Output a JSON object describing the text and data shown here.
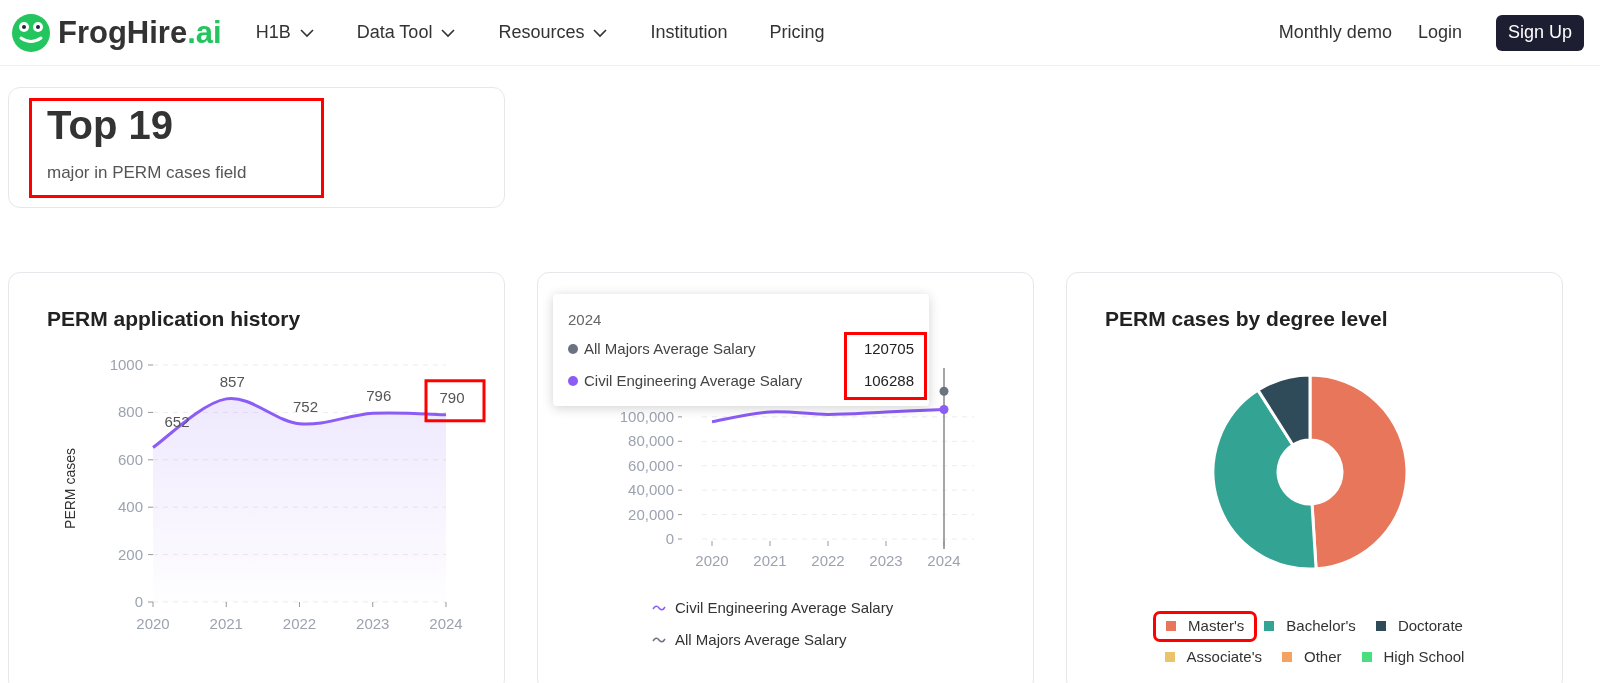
{
  "brand": {
    "name": "FrogHire",
    "suffix": ".ai"
  },
  "nav": {
    "items": [
      {
        "label": "H1B",
        "dropdown": true
      },
      {
        "label": "Data Tool",
        "dropdown": true
      },
      {
        "label": "Resources",
        "dropdown": true
      },
      {
        "label": "Institution",
        "dropdown": false
      },
      {
        "label": "Pricing",
        "dropdown": false
      }
    ],
    "right": [
      {
        "label": "Monthly demo",
        "kind": "link"
      },
      {
        "label": "Login",
        "kind": "link"
      },
      {
        "label": "Sign Up",
        "kind": "primary"
      }
    ]
  },
  "stat_card": {
    "value": "Top 19",
    "caption": "major in PERM cases field",
    "highlighted": true
  },
  "history_card": {
    "title": "PERM application history",
    "last_label_highlighted": true,
    "chart_data": {
      "type": "area",
      "ylabel": "PERM cases",
      "categories": [
        "2020",
        "2021",
        "2022",
        "2023",
        "2024"
      ],
      "values": [
        652,
        857,
        752,
        796,
        790
      ],
      "ylim": [
        0,
        1000
      ],
      "yticks": [
        0,
        200,
        400,
        600,
        800,
        1000
      ],
      "grid": true,
      "data_labels": true
    }
  },
  "salary_card": {
    "chart_data": {
      "type": "line",
      "categories": [
        "2020",
        "2021",
        "2022",
        "2023",
        "2024"
      ],
      "series": [
        {
          "name": "Civil Engineering Average Salary",
          "color": "#8b5cf6",
          "values": [
            96000,
            104000,
            102000,
            104000,
            106000
          ],
          "marker": true
        },
        {
          "name": "All Majors Average Salary",
          "color": "#6b7280",
          "values": [
            null,
            null,
            null,
            null,
            121000
          ],
          "marker": true
        }
      ],
      "ylim": [
        0,
        140000
      ],
      "ref_lines": [
        {
          "axis": "x",
          "value": "2024"
        }
      ],
      "grid": true,
      "yticks": [
        {
          "value": 0,
          "label": "0"
        },
        {
          "value": 20000,
          "label": "20,000"
        },
        {
          "value": 40000,
          "label": "40,000"
        },
        {
          "value": 60000,
          "label": "60,000"
        },
        {
          "value": 80000,
          "label": "80,000"
        },
        {
          "value": 100000,
          "label": "100,000"
        }
      ]
    },
    "tooltip": {
      "title": "2024",
      "values_highlighted": true,
      "rows": [
        {
          "name": "All Majors Average Salary",
          "value": "120705",
          "color": "#6b7280"
        },
        {
          "name": "Civil Engineering Average Salary",
          "value": "106288",
          "color": "#8b5cf6"
        }
      ]
    }
  },
  "degree_card": {
    "title": "PERM cases by degree level",
    "legend": [
      {
        "label": "Master's",
        "color": "#e8765a",
        "highlighted": true
      },
      {
        "label": "Bachelor's",
        "color": "#33a394",
        "highlighted": false
      },
      {
        "label": "Doctorate",
        "color": "#2f4b5a",
        "highlighted": false
      },
      {
        "label": "Associate's",
        "color": "#e9c46a",
        "highlighted": false
      },
      {
        "label": "Other",
        "color": "#f4a261",
        "highlighted": false
      },
      {
        "label": "High School",
        "color": "#4ade80",
        "highlighted": false
      }
    ]
  }
}
